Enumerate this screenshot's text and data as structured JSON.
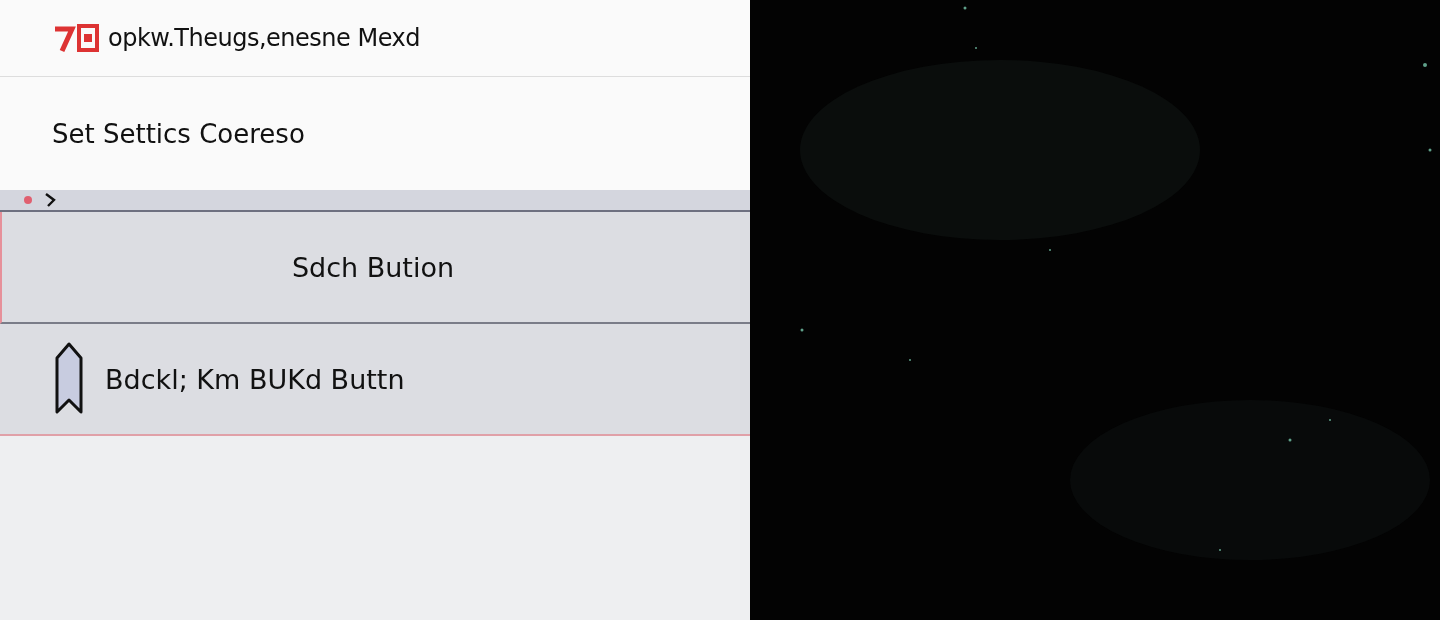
{
  "header": {
    "title": "opkw.Theugs,enesne Mexd"
  },
  "section_title": "Set Settics Coereso",
  "buttons": [
    {
      "label": "Sdch Bution",
      "kind": "plain"
    },
    {
      "label": "Bdckl; Km BUKd Buttn",
      "kind": "arrow"
    }
  ]
}
